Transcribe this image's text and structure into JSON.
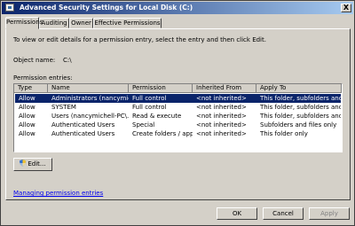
{
  "window": {
    "title": "Advanced Security Settings for Local Disk (C:)",
    "close_glyph": "X"
  },
  "tabs": [
    {
      "label": "Permissions"
    },
    {
      "label": "Auditing"
    },
    {
      "label": "Owner"
    },
    {
      "label": "Effective Permissions"
    }
  ],
  "instructions": "To view or edit details for a permission entry, select the entry and then click Edit.",
  "object": {
    "label": "Object name:",
    "value": "C:\\"
  },
  "entries_label": "Permission entries:",
  "columns": [
    "Type",
    "Name",
    "Permission",
    "Inherited From",
    "Apply To"
  ],
  "rows": [
    {
      "type": "Allow",
      "name": "Administrators (nancymich...",
      "permission": "Full control",
      "inherited": "<not inherited>",
      "apply": "This folder, subfolders and..."
    },
    {
      "type": "Allow",
      "name": "SYSTEM",
      "permission": "Full control",
      "inherited": "<not inherited>",
      "apply": "This folder, subfolders and..."
    },
    {
      "type": "Allow",
      "name": "Users (nancymichell-PC\\...",
      "permission": "Read & execute",
      "inherited": "<not inherited>",
      "apply": "This folder, subfolders and..."
    },
    {
      "type": "Allow",
      "name": "Authenticated Users",
      "permission": "Special",
      "inherited": "<not inherited>",
      "apply": "Subfolders and files only"
    },
    {
      "type": "Allow",
      "name": "Authenticated Users",
      "permission": "Create folders / app...",
      "inherited": "<not inherited>",
      "apply": "This folder only"
    }
  ],
  "edit_button": "Edit...",
  "link": "Managing permission entries",
  "buttons": {
    "ok": "OK",
    "cancel": "Cancel",
    "apply": "Apply"
  },
  "colors": {
    "selection": "#0a246a",
    "dialog": "#d4d0c8",
    "link": "#0000ee"
  }
}
